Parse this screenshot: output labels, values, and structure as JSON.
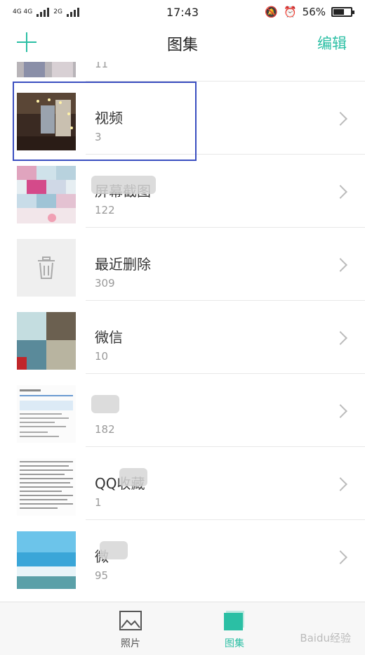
{
  "status_bar": {
    "network_1": "4G 4G",
    "network_2": "2G",
    "time": "17:43",
    "battery": "56%",
    "battery_level": 0.56
  },
  "header": {
    "title": "图集",
    "edit_label": "编辑",
    "add_icon": "plus-icon"
  },
  "albums": [
    {
      "name": "视频",
      "count": "3"
    },
    {
      "name": "屏幕截图",
      "count": "122"
    },
    {
      "name": "最近删除",
      "count": "309"
    },
    {
      "name": "微信",
      "count": "10"
    },
    {
      "name": "",
      "count": "182"
    },
    {
      "name": "QQ收藏",
      "count": "1"
    },
    {
      "name": "微",
      "count": "95"
    }
  ],
  "tabs": [
    {
      "label": "照片",
      "icon": "image-icon"
    },
    {
      "label": "图集",
      "icon": "album-icon"
    }
  ],
  "watermark": "Baidu经验",
  "colors": {
    "accent": "#2bbfa4",
    "highlight_box": "#3a4ec0"
  }
}
